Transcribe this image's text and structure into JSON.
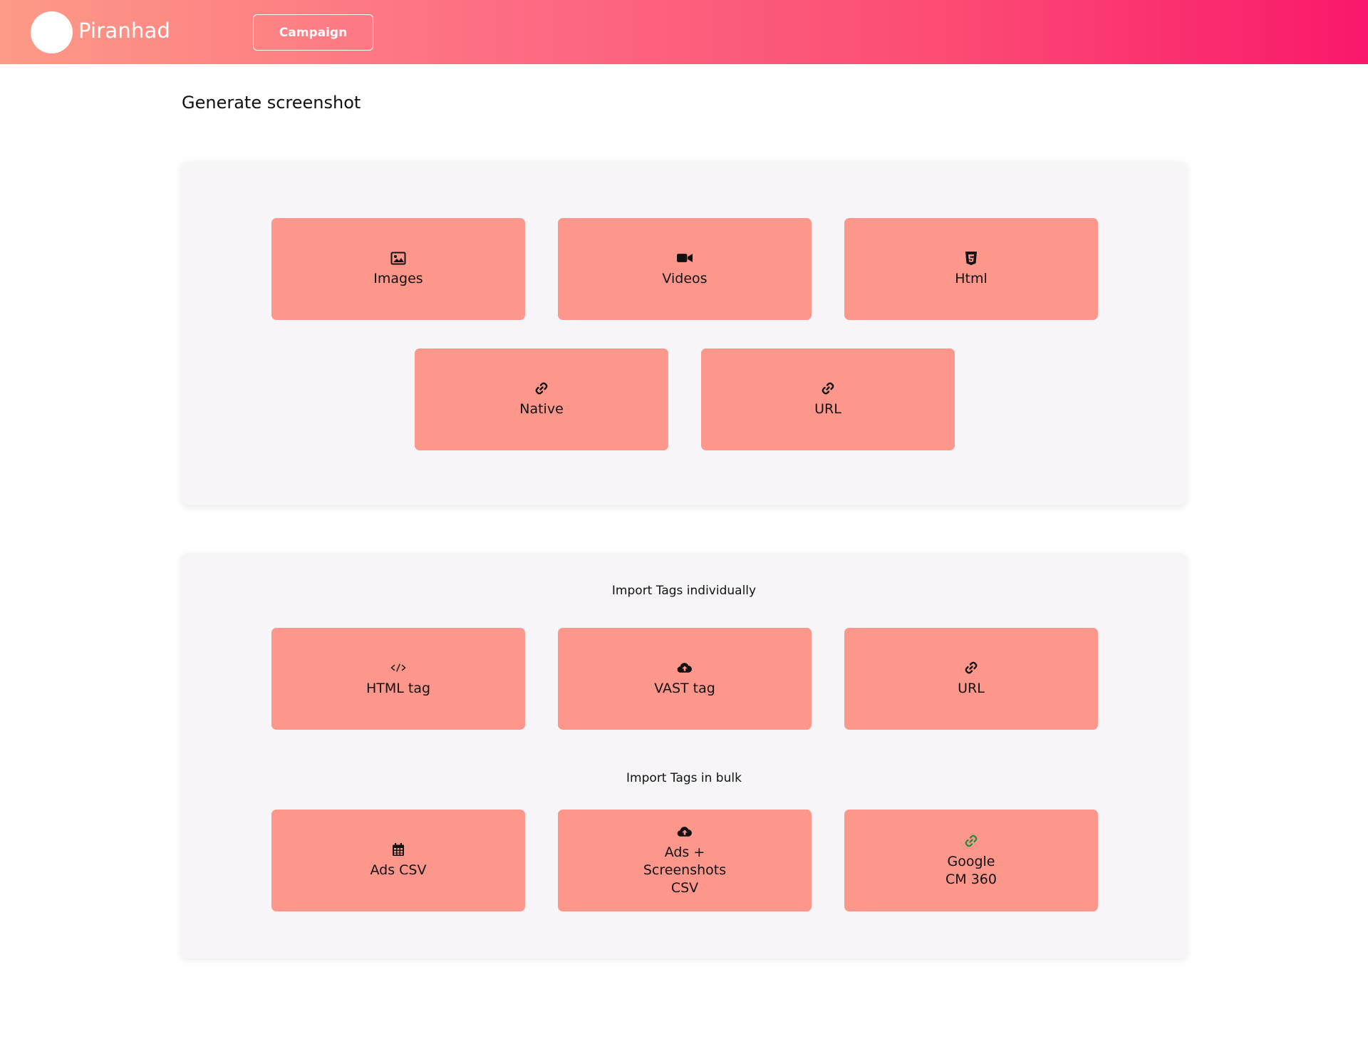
{
  "header": {
    "brand": "Piranhad",
    "campaign_label": "Campaign"
  },
  "page": {
    "title": "Generate screenshot"
  },
  "generate_panel": {
    "tiles": [
      {
        "label": "Images",
        "icon": "image-icon"
      },
      {
        "label": "Videos",
        "icon": "video-camera-icon"
      },
      {
        "label": "Html",
        "icon": "html5-icon"
      },
      {
        "label": "Native",
        "icon": "link-icon"
      },
      {
        "label": "URL",
        "icon": "link-icon"
      }
    ]
  },
  "import_panel": {
    "individual_heading": "Import Tags individually",
    "individual_tiles": [
      {
        "label": "HTML tag",
        "icon": "code-icon"
      },
      {
        "label": "VAST tag",
        "icon": "cloud-upload-icon"
      },
      {
        "label": "URL",
        "icon": "link-icon"
      }
    ],
    "bulk_heading": "Import Tags in bulk",
    "bulk_tiles": [
      {
        "label": "Ads CSV",
        "icon": "calendar-icon"
      },
      {
        "label": "Ads +\nScreenshots\nCSV",
        "icon": "cloud-upload-icon"
      },
      {
        "label": "Google\nCM 360",
        "icon": "link-icon",
        "icon_color": "#2e8b3a"
      }
    ]
  },
  "colors": {
    "tile": "#fd968b",
    "panel": "#f7f5f8",
    "header_start": "#fd9a86",
    "header_end": "#f9186b"
  }
}
